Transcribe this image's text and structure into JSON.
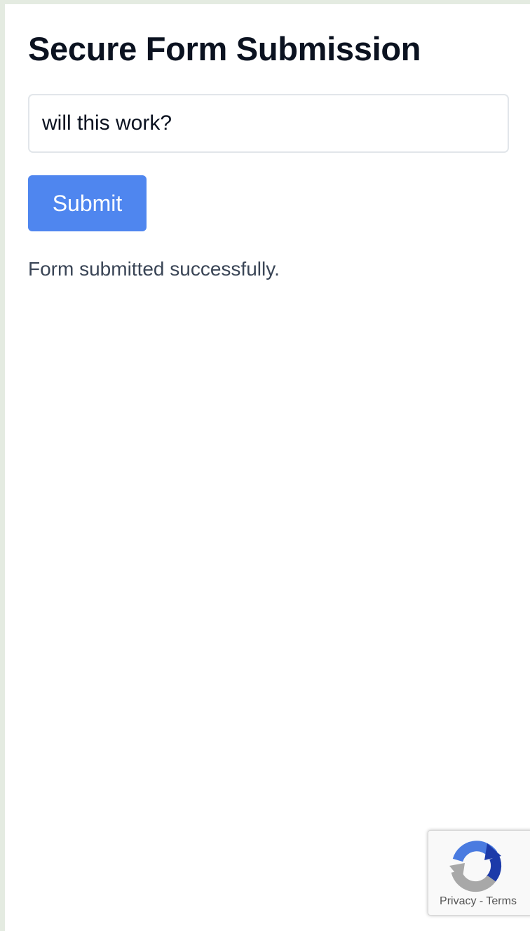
{
  "form": {
    "title": "Secure Form Submission",
    "input_value": "will this work?",
    "submit_label": "Submit",
    "status_message": "Form submitted successfully."
  },
  "recaptcha": {
    "privacy_label": "Privacy",
    "separator": "-",
    "terms_label": "Terms"
  },
  "colors": {
    "submit_button": "#4f86ef",
    "background": "#e4ebe1"
  },
  "icons": {
    "recaptcha": "recaptcha-logo-icon"
  }
}
